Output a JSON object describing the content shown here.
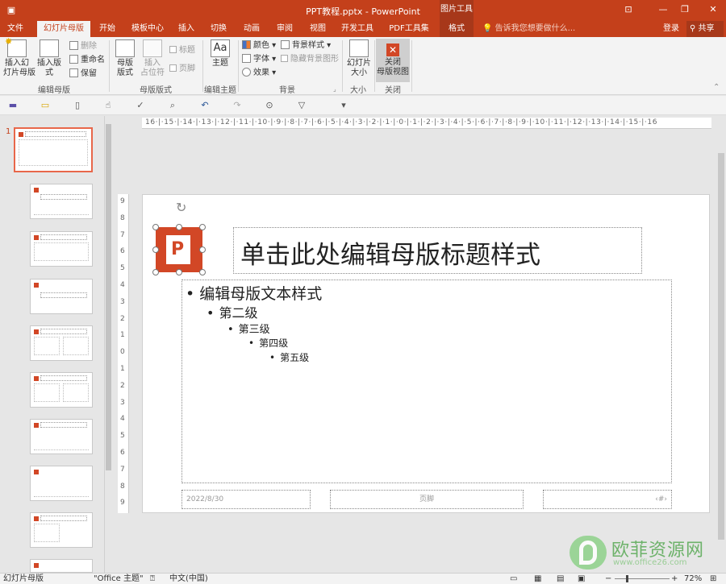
{
  "window": {
    "title": "PPT教程.pptx - PowerPoint",
    "context_group": "图片工具",
    "minimize": "—",
    "restore": "❐",
    "close": "✕"
  },
  "tabs": [
    "文件",
    "幻灯片母版",
    "开始",
    "模板中心",
    "插入",
    "切换",
    "动画",
    "审阅",
    "视图",
    "开发工具",
    "PDF工具集",
    "格式"
  ],
  "tell_me": "告诉我您想要做什么...",
  "account": {
    "login": "登录",
    "share": "共享"
  },
  "ribbon": {
    "insert_master": "插入幻\n灯片母版",
    "insert_layout": "插入版式",
    "delete": "删除",
    "rename": "重命名",
    "preserve": "保留",
    "group_edit_master": "编辑母版",
    "master_layout": "母版\n版式",
    "insert_placeholder": "插入\n占位符",
    "title_cb": "标题",
    "footer_cb": "页脚",
    "group_master_layout": "母版版式",
    "themes": "主题",
    "group_edit_theme": "编辑主题",
    "colors": "颜色",
    "fonts": "字体",
    "effects": "效果",
    "bg_styles": "背景样式",
    "hide_bg": "隐藏背景图形",
    "group_background": "背景",
    "slide_size": "幻灯片\n大小",
    "group_size": "大小",
    "close_master": "关闭\n母版视图",
    "group_close": "关闭"
  },
  "qat_icons": [
    "save-icon",
    "open-icon",
    "new-icon",
    "touch-icon",
    "spellcheck-icon",
    "preview-icon",
    "undo-icon",
    "redo-icon",
    "present-icon",
    "slideshow-icon",
    "customize-icon"
  ],
  "thumbnails": {
    "selected_number": "1"
  },
  "hruler_labels": "16·|·15·|·14·|·13·|·12·|·11·|·10·|·9·|·8·|·7·|·6·|·5·|·4·|·3·|·2·|·1·|·0·|·1·|·2·|·3·|·4·|·5·|·6·|·7·|·8·|·9·|·10·|·11·|·12·|·13·|·14·|·15·|·16",
  "vruler_labels": [
    "9",
    "8",
    "7",
    "6",
    "5",
    "4",
    "3",
    "2",
    "1",
    "0",
    "1",
    "2",
    "3",
    "4",
    "5",
    "6",
    "7",
    "8",
    "9"
  ],
  "slide": {
    "title": "单击此处编辑母版标题样式",
    "levels": [
      "编辑母版文本样式",
      "第二级",
      "第三级",
      "第四级",
      "第五级"
    ],
    "footer_date": "2022/8/30",
    "footer_text": "页脚",
    "footer_num": "‹#›"
  },
  "status": {
    "view": "幻灯片母版",
    "theme": "\"Office 主题\"",
    "language": "中文(中国)",
    "zoom": "72%"
  },
  "watermark": {
    "name": "欧菲资源网",
    "url": "www.office26.com"
  }
}
